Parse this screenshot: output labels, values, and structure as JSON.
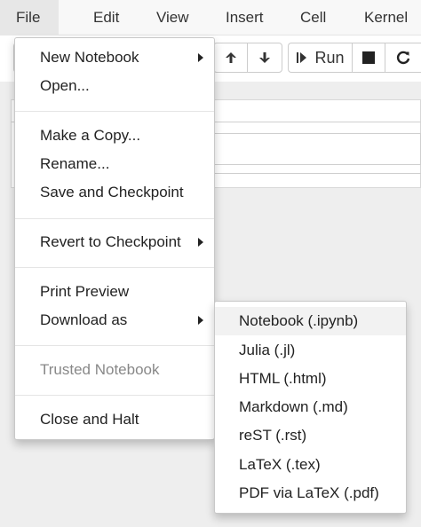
{
  "menubar": {
    "items": [
      "File",
      "Edit",
      "View",
      "Insert",
      "Cell",
      "Kernel"
    ],
    "active": "File"
  },
  "toolbar": {
    "up_icon": "arrow-up-icon",
    "down_icon": "arrow-down-icon",
    "run_label": "Run",
    "run_icon": "step-forward-icon",
    "stop_icon": "stop-icon",
    "restart_icon": "restart-icon"
  },
  "file_menu": {
    "new_notebook": "New Notebook",
    "open": "Open...",
    "make_copy": "Make a Copy...",
    "rename": "Rename...",
    "save_checkpoint": "Save and Checkpoint",
    "revert_checkpoint": "Revert to Checkpoint",
    "print_preview": "Print Preview",
    "download_as": "Download as",
    "trusted_notebook": "Trusted Notebook",
    "close_halt": "Close and Halt"
  },
  "download_menu": {
    "items": [
      "Notebook (.ipynb)",
      "Julia (.jl)",
      "HTML (.html)",
      "Markdown (.md)",
      "reST (.rst)",
      "LaTeX (.tex)",
      "PDF via LaTeX (.pdf)"
    ],
    "highlighted": "Notebook (.ipynb)"
  },
  "colors": {
    "menubar_bg": "#f8f8f8",
    "active_menu_bg": "#e7e7e7",
    "disabled_text": "#888888",
    "hover_bg": "#f2f2f2"
  }
}
